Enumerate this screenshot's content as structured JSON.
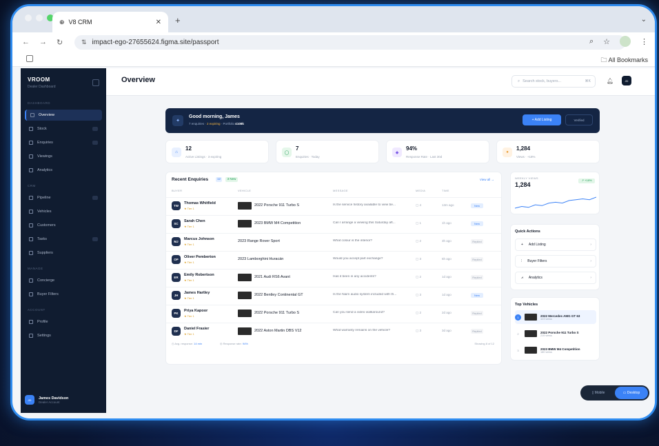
{
  "browser": {
    "tab_title": "V8 CRM",
    "url": "impact-ego-27655624.figma.site/passport",
    "bookmarks_label": "All Bookmarks"
  },
  "sidebar": {
    "brand": "VROOM",
    "brand_sub": "Dealer Dashboard",
    "section_dashboard": "DASHBOARD",
    "section_crm": "CRM",
    "section_manage": "MANAGE",
    "section_account": "ACCOUNT",
    "items": [
      {
        "label": "Overview"
      },
      {
        "label": "Stock"
      },
      {
        "label": "Enquiries"
      },
      {
        "label": "Viewings"
      },
      {
        "label": "Analytics"
      },
      {
        "label": "Pipeline"
      },
      {
        "label": "Vehicles"
      },
      {
        "label": "Customers"
      },
      {
        "label": "Tasks"
      },
      {
        "label": "Suppliers"
      },
      {
        "label": "Concierge"
      },
      {
        "label": "Buyer Filters"
      },
      {
        "label": "Profile"
      },
      {
        "label": "Settings"
      }
    ],
    "user": {
      "initials": "JD",
      "name": "James Davidson",
      "role": "Dealer Account"
    }
  },
  "header": {
    "title": "Overview",
    "search_placeholder": "Search stock, buyers...",
    "search_kbd": "⌘K",
    "user_initials": "JD"
  },
  "hero": {
    "greeting": "Good morning, James",
    "sub_a": "7 enquiries",
    "sub_b": "2 expiring",
    "sub_c": "Portfolio",
    "sub_d": "£108k",
    "add_label": "+ Add Listing",
    "verified_label": "Verified"
  },
  "stats": [
    {
      "value": "12",
      "label": "Active Listings · 3 expiring"
    },
    {
      "value": "7",
      "label": "Enquiries · Today"
    },
    {
      "value": "94%",
      "label": "Response Rate · Last 30d"
    },
    {
      "value": "1,284",
      "label": "Views · +18%"
    }
  ],
  "enquiries": {
    "title": "Recent Enquiries",
    "count": "12",
    "new_badge": "3 New",
    "view_all": "View all →",
    "columns": [
      "BUYER",
      "VEHICLE",
      "MESSAGE",
      "MEDIA",
      "TIME"
    ],
    "rows": [
      {
        "initials": "TW",
        "name": "Thomas Whitfield",
        "tier": "★ Tier 1",
        "vehicle": "2022 Porsche 911 Turbo S",
        "has_img": true,
        "message": "Is the service history available to view be...",
        "media": "▢ 4",
        "time": "13m ago",
        "status": "New",
        "status_type": "new"
      },
      {
        "initials": "SC",
        "name": "Sarah Chen",
        "tier": "★ Tier 1",
        "vehicle": "2023 BMW M4 Competition",
        "has_img": true,
        "message": "Can I arrange a viewing this Saturday aft...",
        "media": "▢ 1",
        "time": "1h ago",
        "status": "New",
        "status_type": "new"
      },
      {
        "initials": "MJ",
        "name": "Marcus Johnson",
        "tier": "★ Tier 1",
        "vehicle": "2023 Range Rover Sport",
        "has_img": false,
        "message": "What colour is the interior?",
        "media": "▢ 2",
        "time": "3h ago",
        "status": "Replied",
        "status_type": "rep"
      },
      {
        "initials": "OP",
        "name": "Oliver Pemberton",
        "tier": "★ Tier 1",
        "vehicle": "2023 Lamborghini Huracán",
        "has_img": false,
        "message": "Would you accept part exchange?",
        "media": "▢ 3",
        "time": "5h ago",
        "status": "Replied",
        "status_type": "rep"
      },
      {
        "initials": "ER",
        "name": "Emily Robertson",
        "tier": "★ Tier 1",
        "vehicle": "2021 Audi RS6 Avant",
        "has_img": true,
        "message": "Has it been in any accidents?",
        "media": "▢ 2",
        "time": "1d ago",
        "status": "Replied",
        "status_type": "rep"
      },
      {
        "initials": "JH",
        "name": "James Hartley",
        "tier": "★ Tier 1",
        "vehicle": "2022 Bentley Continental GT",
        "has_img": true,
        "message": "Is the Naim audio system included with th...",
        "media": "▢ 3",
        "time": "1d ago",
        "status": "New",
        "status_type": "new"
      },
      {
        "initials": "PK",
        "name": "Priya Kapoor",
        "tier": "★ Tier 1",
        "vehicle": "2022 Porsche 911 Turbo S",
        "has_img": true,
        "message": "Can you send a video walkaround?",
        "media": "▢ 2",
        "time": "2d ago",
        "status": "Replied",
        "status_type": "rep"
      },
      {
        "initials": "DF",
        "name": "Daniel Frasier",
        "tier": "★ Tier 1",
        "vehicle": "2022 Aston Martin DBS V12",
        "has_img": true,
        "message": "What warranty remains on the vehicle?",
        "media": "▢ 3",
        "time": "3d ago",
        "status": "Replied",
        "status_type": "rep"
      }
    ],
    "footer_avg_label": "◷ Avg. response:",
    "footer_avg_value": "14 min",
    "footer_rate_label": "◎ Response rate:",
    "footer_rate_value": "94%",
    "footer_showing": "Showing 8 of 12"
  },
  "weekly": {
    "title": "WEEKLY VIEWS",
    "value": "1,284",
    "delta": "↗ +18%",
    "series": [
      40,
      42,
      41,
      44,
      43,
      46,
      47,
      46,
      49,
      50,
      51,
      50,
      53
    ]
  },
  "quick_actions": {
    "title": "Quick Actions",
    "items": [
      {
        "label": "Add Listing"
      },
      {
        "label": "Buyer Filters"
      },
      {
        "label": "Analytics"
      }
    ]
  },
  "top_vehicles": {
    "title": "Top Vehicles",
    "items": [
      {
        "rank": "1",
        "name": "2022 Mercedes AMG GT 63",
        "sub": "423 views"
      },
      {
        "rank": "2",
        "name": "2022 Porsche 911 Turbo S",
        "sub": "219 views"
      },
      {
        "rank": "3",
        "name": "2023 BMW M4 Competition",
        "sub": "180 views"
      }
    ]
  },
  "toggle": {
    "mobile": "▯ Mobile",
    "desktop": "▭ Desktop"
  }
}
